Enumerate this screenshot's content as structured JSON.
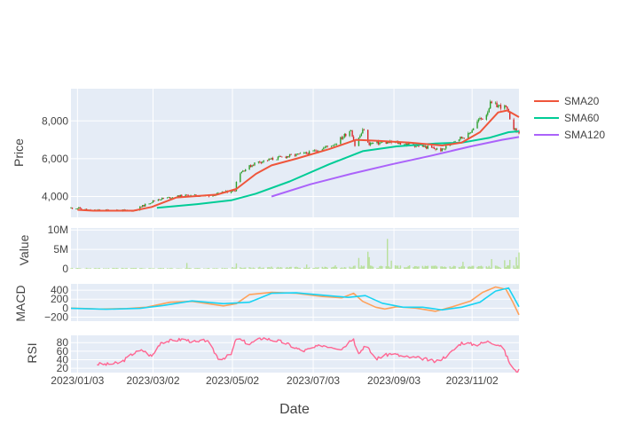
{
  "chart_data": {
    "type": "candlestick-with-indicators",
    "x_axis": {
      "label": "Date",
      "tick_labels": [
        "2023/01/03",
        "2023/03/02",
        "2023/05/02",
        "2023/07/03",
        "2023/09/03",
        "2023/11/02"
      ],
      "range": [
        "2022-12-29",
        "2023-12-08"
      ]
    },
    "legend": {
      "placement": "top-right",
      "items": [
        {
          "name": "SMA20",
          "color": "#EF553B"
        },
        {
          "name": "SMA60",
          "color": "#00CC96"
        },
        {
          "name": "SMA120",
          "color": "#AB63FA"
        }
      ]
    },
    "colors": {
      "increasing": "#2ca02c",
      "decreasing": "#d62728",
      "volume": "#b8e09a",
      "macd": "#FFA15A",
      "signal": "#19D3F3",
      "rsi": "#FF6692",
      "plot_bg": "#E5ECF6"
    },
    "panels": {
      "price": {
        "ylabel": "Price",
        "ylim": [
          2900,
          9700
        ],
        "ticks": [
          4000,
          6000,
          8000
        ],
        "tick_labels": [
          "4,000",
          "6,000",
          "8,000"
        ],
        "close_anchors": [
          [
            "2022-12-29",
            3400
          ],
          [
            "2023-01-05",
            3380
          ],
          [
            "2023-01-12",
            3270
          ],
          [
            "2023-02-01",
            3280
          ],
          [
            "2023-02-15",
            3250
          ],
          [
            "2023-02-22",
            3500
          ],
          [
            "2023-03-05",
            3850
          ],
          [
            "2023-03-25",
            4050
          ],
          [
            "2023-04-15",
            4050
          ],
          [
            "2023-05-01",
            4300
          ],
          [
            "2023-05-04",
            4350
          ],
          [
            "2023-05-06",
            5200
          ],
          [
            "2023-05-20",
            5800
          ],
          [
            "2023-06-10",
            6100
          ],
          [
            "2023-06-30",
            6300
          ],
          [
            "2023-07-20",
            6800
          ],
          [
            "2023-08-01",
            7550
          ],
          [
            "2023-08-04",
            6700
          ],
          [
            "2023-08-11",
            7600
          ],
          [
            "2023-08-14",
            6800
          ],
          [
            "2023-08-25",
            6850
          ],
          [
            "2023-09-05",
            6850
          ],
          [
            "2023-09-25",
            6650
          ],
          [
            "2023-10-10",
            6450
          ],
          [
            "2023-10-20",
            7000
          ],
          [
            "2023-10-30",
            7250
          ],
          [
            "2023-11-07",
            8050
          ],
          [
            "2023-11-12",
            8200
          ],
          [
            "2023-11-16",
            8900
          ],
          [
            "2023-11-28",
            8700
          ],
          [
            "2023-12-03",
            7800
          ],
          [
            "2023-12-05",
            7500
          ],
          [
            "2023-12-08",
            7400
          ]
        ],
        "sma20": [
          [
            "2023-01-03",
            3300
          ],
          [
            "2023-01-15",
            3250
          ],
          [
            "2023-02-15",
            3250
          ],
          [
            "2023-03-01",
            3450
          ],
          [
            "2023-03-20",
            3950
          ],
          [
            "2023-04-20",
            4100
          ],
          [
            "2023-05-05",
            4400
          ],
          [
            "2023-05-20",
            5200
          ],
          [
            "2023-06-01",
            5650
          ],
          [
            "2023-06-20",
            6000
          ],
          [
            "2023-07-15",
            6500
          ],
          [
            "2023-08-05",
            7000
          ],
          [
            "2023-08-20",
            6950
          ],
          [
            "2023-09-15",
            6850
          ],
          [
            "2023-10-10",
            6700
          ],
          [
            "2023-10-25",
            6850
          ],
          [
            "2023-11-08",
            7400
          ],
          [
            "2023-11-22",
            8450
          ],
          [
            "2023-11-29",
            8550
          ],
          [
            "2023-12-08",
            8200
          ]
        ],
        "sma60": [
          [
            "2023-03-05",
            3400
          ],
          [
            "2023-04-05",
            3600
          ],
          [
            "2023-05-01",
            3800
          ],
          [
            "2023-05-20",
            4150
          ],
          [
            "2023-06-15",
            4800
          ],
          [
            "2023-07-15",
            5700
          ],
          [
            "2023-08-10",
            6400
          ],
          [
            "2023-09-05",
            6650
          ],
          [
            "2023-10-05",
            6800
          ],
          [
            "2023-10-25",
            6850
          ],
          [
            "2023-11-15",
            7100
          ],
          [
            "2023-11-30",
            7400
          ],
          [
            "2023-12-08",
            7450
          ]
        ],
        "sma120": [
          [
            "2023-06-01",
            4000
          ],
          [
            "2023-07-01",
            4650
          ],
          [
            "2023-08-01",
            5200
          ],
          [
            "2023-09-01",
            5700
          ],
          [
            "2023-10-01",
            6150
          ],
          [
            "2023-11-01",
            6650
          ],
          [
            "2023-11-25",
            7000
          ],
          [
            "2023-12-08",
            7150
          ]
        ]
      },
      "volume": {
        "ylabel": "Value",
        "ylim": [
          0,
          10500000
        ],
        "ticks": [
          0,
          5000000,
          10000000
        ],
        "tick_labels": [
          "0",
          "5M",
          "10M"
        ],
        "spikes": [
          [
            "2023-03-28",
            1500000
          ],
          [
            "2023-04-02",
            2000000
          ],
          [
            "2023-05-05",
            1400000
          ],
          [
            "2023-06-28",
            1100000
          ],
          [
            "2023-07-20",
            900000
          ],
          [
            "2023-08-05",
            6900000
          ],
          [
            "2023-08-07",
            2800000
          ],
          [
            "2023-08-12",
            9600000
          ],
          [
            "2023-08-14",
            4400000
          ],
          [
            "2023-08-15",
            3000000
          ],
          [
            "2023-08-29",
            7700000
          ],
          [
            "2023-09-01",
            2100000
          ],
          [
            "2023-09-16",
            2000000
          ],
          [
            "2023-10-26",
            1800000
          ],
          [
            "2023-11-05",
            1600000
          ],
          [
            "2023-11-17",
            2500000
          ],
          [
            "2023-11-27",
            2200000
          ],
          [
            "2023-12-01",
            2300000
          ],
          [
            "2023-12-06",
            3000000
          ],
          [
            "2023-12-08",
            4200000
          ]
        ]
      },
      "macd": {
        "ylabel": "MACD",
        "ylim": [
          -290,
          540
        ],
        "ticks": [
          -200,
          0,
          200,
          400
        ],
        "tick_labels": [
          "−200",
          "0",
          "200",
          "400"
        ],
        "macd": [
          [
            "2022-12-29",
            0
          ],
          [
            "2023-01-20",
            -20
          ],
          [
            "2023-02-10",
            -10
          ],
          [
            "2023-02-25",
            20
          ],
          [
            "2023-03-15",
            130
          ],
          [
            "2023-04-01",
            150
          ],
          [
            "2023-04-25",
            50
          ],
          [
            "2023-05-05",
            100
          ],
          [
            "2023-05-15",
            300
          ],
          [
            "2023-06-01",
            350
          ],
          [
            "2023-06-20",
            330
          ],
          [
            "2023-07-10",
            260
          ],
          [
            "2023-07-25",
            230
          ],
          [
            "2023-08-03",
            330
          ],
          [
            "2023-08-10",
            150
          ],
          [
            "2023-08-20",
            20
          ],
          [
            "2023-08-27",
            -20
          ],
          [
            "2023-09-05",
            30
          ],
          [
            "2023-09-20",
            0
          ],
          [
            "2023-10-05",
            -70
          ],
          [
            "2023-10-18",
            30
          ],
          [
            "2023-11-01",
            160
          ],
          [
            "2023-11-10",
            350
          ],
          [
            "2023-11-20",
            470
          ],
          [
            "2023-11-28",
            420
          ],
          [
            "2023-12-03",
            150
          ],
          [
            "2023-12-08",
            -150
          ]
        ],
        "signal": [
          [
            "2022-12-29",
            -5
          ],
          [
            "2023-01-25",
            -25
          ],
          [
            "2023-02-20",
            -5
          ],
          [
            "2023-03-10",
            60
          ],
          [
            "2023-04-01",
            160
          ],
          [
            "2023-04-25",
            100
          ],
          [
            "2023-05-15",
            130
          ],
          [
            "2023-06-01",
            330
          ],
          [
            "2023-06-20",
            340
          ],
          [
            "2023-07-10",
            290
          ],
          [
            "2023-07-30",
            240
          ],
          [
            "2023-08-12",
            280
          ],
          [
            "2023-08-25",
            110
          ],
          [
            "2023-09-10",
            20
          ],
          [
            "2023-09-25",
            20
          ],
          [
            "2023-10-10",
            -40
          ],
          [
            "2023-10-25",
            20
          ],
          [
            "2023-11-08",
            130
          ],
          [
            "2023-11-20",
            380
          ],
          [
            "2023-11-30",
            450
          ],
          [
            "2023-12-08",
            30
          ]
        ]
      },
      "rsi": {
        "ylabel": "RSI",
        "ylim": [
          10,
          97
        ],
        "ticks": [
          20,
          40,
          60,
          80
        ],
        "tick_labels": [
          "20",
          "40",
          "60",
          "80"
        ],
        "rsi": [
          [
            "2023-01-18",
            30
          ],
          [
            "2023-01-25",
            29
          ],
          [
            "2023-02-05",
            33
          ],
          [
            "2023-02-15",
            55
          ],
          [
            "2023-02-22",
            62
          ],
          [
            "2023-03-01",
            48
          ],
          [
            "2023-03-08",
            81
          ],
          [
            "2023-03-25",
            88
          ],
          [
            "2023-04-05",
            80
          ],
          [
            "2023-04-12",
            86
          ],
          [
            "2023-04-22",
            40
          ],
          [
            "2023-05-01",
            52
          ],
          [
            "2023-05-05",
            90
          ],
          [
            "2023-05-15",
            77
          ],
          [
            "2023-05-25",
            91
          ],
          [
            "2023-06-10",
            81
          ],
          [
            "2023-06-25",
            60
          ],
          [
            "2023-07-10",
            74
          ],
          [
            "2023-07-25",
            66
          ],
          [
            "2023-08-03",
            92
          ],
          [
            "2023-08-06",
            50
          ],
          [
            "2023-08-12",
            75
          ],
          [
            "2023-08-20",
            42
          ],
          [
            "2023-09-01",
            55
          ],
          [
            "2023-09-10",
            47
          ],
          [
            "2023-09-25",
            43
          ],
          [
            "2023-10-05",
            35
          ],
          [
            "2023-10-15",
            52
          ],
          [
            "2023-10-25",
            80
          ],
          [
            "2023-11-05",
            75
          ],
          [
            "2023-11-15",
            83
          ],
          [
            "2023-11-25",
            72
          ],
          [
            "2023-12-02",
            25
          ],
          [
            "2023-12-05",
            14
          ],
          [
            "2023-12-08",
            15
          ]
        ]
      }
    }
  }
}
